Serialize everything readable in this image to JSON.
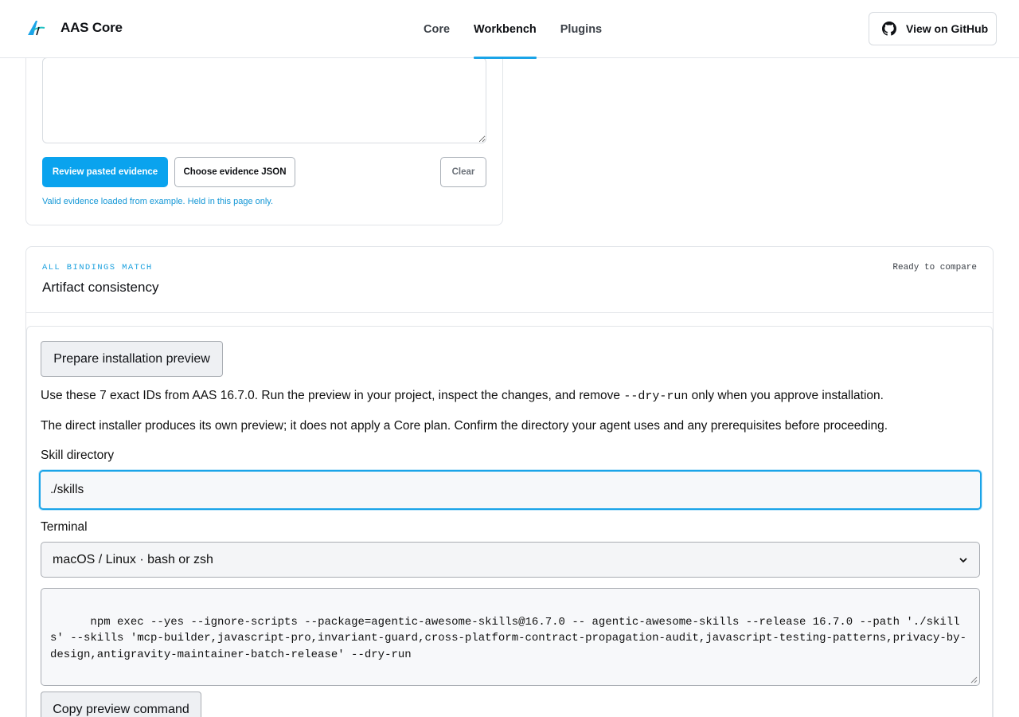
{
  "header": {
    "brand": "AAS Core",
    "nav": [
      {
        "label": "Core",
        "active": false
      },
      {
        "label": "Workbench",
        "active": true
      },
      {
        "label": "Plugins",
        "active": false
      }
    ],
    "github_label": "View on GitHub"
  },
  "evidence": {
    "review_button": "Review pasted evidence",
    "choose_button": "Choose evidence JSON",
    "clear_button": "Clear",
    "status": "Valid evidence loaded from example. Held in this page only."
  },
  "artifact": {
    "eyebrow": "ALL BINDINGS MATCH",
    "title": "Artifact consistency",
    "status": "Ready to compare",
    "prepare_button": "Prepare installation preview",
    "intro_before": "Use these 7 exact IDs from AAS 16.7.0. Run the preview in your project, inspect the changes, and remove ",
    "intro_code": "--dry-run",
    "intro_after": " only when you approve installation.",
    "note": "The direct installer produces its own preview; it does not apply a Core plan. Confirm the directory your agent uses and any prerequisites before proceeding.",
    "skill_dir_label": "Skill directory",
    "skill_dir_value": "./skills",
    "terminal_label": "Terminal",
    "terminal_selected": "macOS / Linux · bash or zsh",
    "command": "npm exec --yes --ignore-scripts --package=agentic-awesome-skills@16.7.0 -- agentic-awesome-skills --release 16.7.0 --path './skills' --skills 'mcp-builder,javascript-pro,invariant-guard,cross-platform-contract-propagation-audit,javascript-testing-patterns,privacy-by-design,antigravity-maintainer-batch-release' --dry-run",
    "copy_button": "Copy preview command"
  },
  "colors": {
    "accent": "#0aa3ee",
    "eyebrow": "#1aa0de"
  },
  "icons": {
    "brand": "brand-logo-icon",
    "github": "github-icon",
    "select": "chevron-down-icon"
  }
}
